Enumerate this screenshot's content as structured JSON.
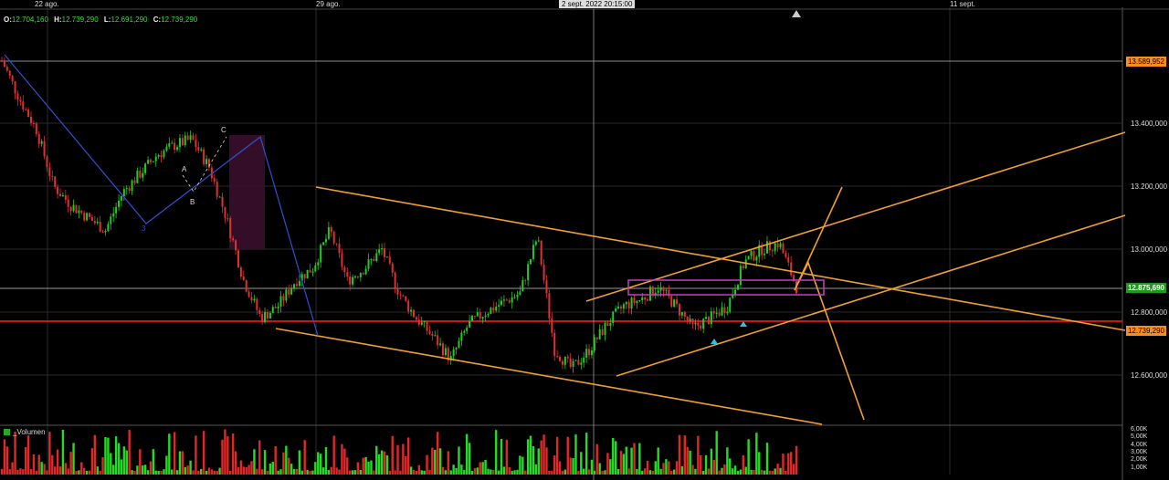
{
  "ohlc": {
    "o_label": "O:",
    "o": "12.704,160",
    "h_label": "H:",
    "h": "12.739,290",
    "l_label": "L:",
    "l": "12.691,290",
    "c_label": "C:",
    "c": "12.739,290"
  },
  "x_axis": {
    "dates": [
      "22 ago.",
      "29 ago.",
      "11 sept."
    ],
    "crosshair_label": "2 sept. 2022 20:15:00"
  },
  "price_axis": {
    "ticks": [
      "13.400,000",
      "13.200,000",
      "13.000,000",
      "12.800,000",
      "12.600,000"
    ]
  },
  "price_labels": {
    "top": "13.589,952",
    "current": "12.875,690",
    "support": "12.739,290"
  },
  "wave_labels": [
    "3",
    "A",
    "B",
    "C"
  ],
  "volume": {
    "label": "_Volumen",
    "ticks": [
      "6,00K",
      "5,00K",
      "4,00K",
      "3,00K",
      "2,00K",
      "1,00K"
    ]
  },
  "chart_data": {
    "type": "candlestick",
    "x_ticks": [
      "22 ago.",
      "29 ago.",
      "11 sept."
    ],
    "y_ticks": [
      13400,
      13200,
      13000,
      12800,
      12600
    ],
    "ylim": [
      12450,
      13650
    ],
    "horizontal_levels": [
      13589.952,
      12875.69,
      12739.29
    ],
    "price_series": [
      13600,
      13480,
      13380,
      13200,
      13140,
      13100,
      13060,
      13180,
      13240,
      13300,
      13330,
      13350,
      13260,
      13100,
      12900,
      12780,
      12820,
      12900,
      12940,
      13060,
      12900,
      12940,
      13000,
      12860,
      12780,
      12720,
      12650,
      12760,
      12800,
      12830,
      12860,
      13040,
      12680,
      12620,
      12680,
      12760,
      12820,
      12840,
      12880,
      12820,
      12750,
      12780,
      12820,
      12960,
      13000,
      13020,
      12880
    ],
    "volume_ticks": [
      6000,
      5000,
      4000,
      3000,
      2000,
      1000
    ]
  },
  "colors": {
    "up": "#22cc22",
    "down": "#e03030",
    "channel": "#f0a030",
    "support": "#ff2020",
    "wave": "#3050d0",
    "zone": "#c040c0"
  }
}
